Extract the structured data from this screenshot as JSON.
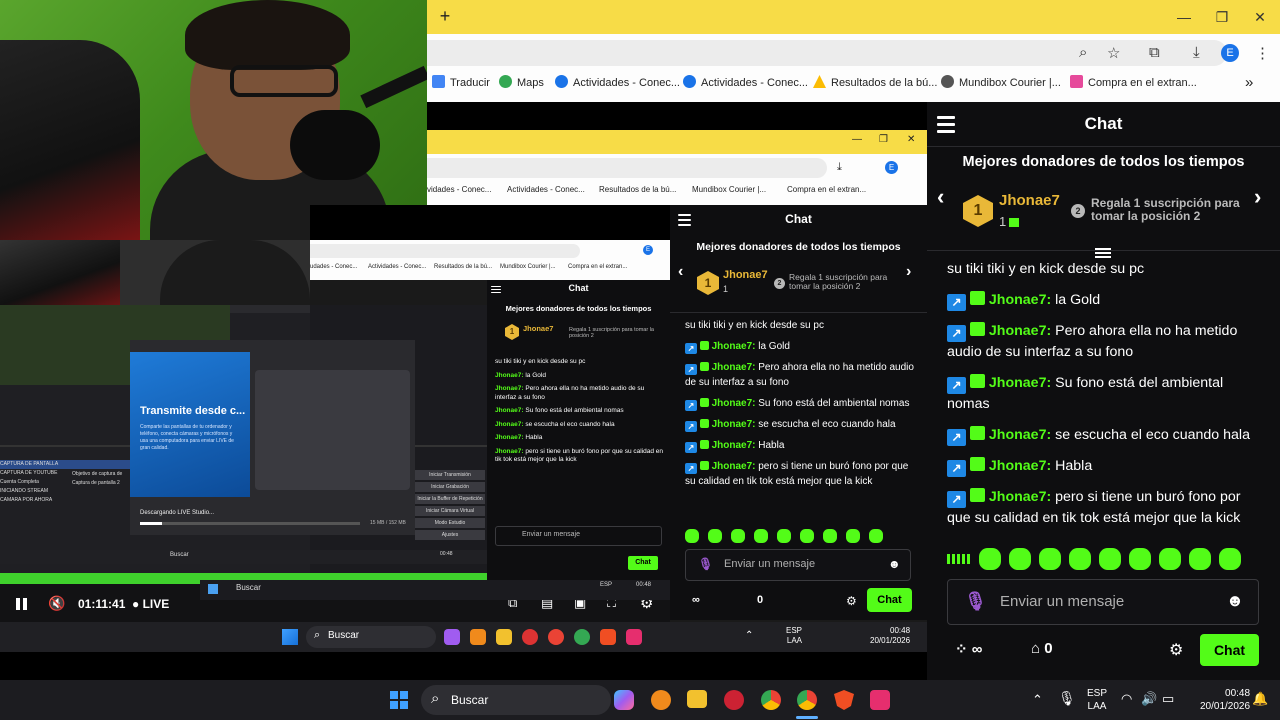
{
  "browser": {
    "avatar_letter": "E",
    "bookmarks": [
      "Traducir",
      "Maps",
      "Actividades - Conec...",
      "Actividades - Conec...",
      "Resultados de la bú...",
      "Mundibox Courier |...",
      "Compra en el extran..."
    ],
    "more": "»"
  },
  "chat": {
    "title": "Chat",
    "donors_title": "Mejores donadores de todos los tiempos",
    "top_donor": {
      "rank": "1",
      "name": "Jhonae7",
      "count": "1"
    },
    "second": {
      "rank": "2",
      "text": "Regala 1 suscripción para tomar la posición 2"
    },
    "messages": [
      {
        "user": "",
        "text": "su tiki tiki y en kick desde su pc"
      },
      {
        "user": "Jhonae7:",
        "text": " la Gold"
      },
      {
        "user": "Jhonae7:",
        "text": " Pero ahora ella no ha metido audio de su interfaz a su fono"
      },
      {
        "user": "Jhonae7:",
        "text": " Su fono está del ambiental nomas"
      },
      {
        "user": "Jhonae7:",
        "text": " se escucha el eco cuando hala"
      },
      {
        "user": "Jhonae7:",
        "text": " Habla"
      },
      {
        "user": "Jhonae7:",
        "text": " pero si tiene un buró fono por que su calidad en tik tok está mejor que la kick"
      }
    ],
    "input_placeholder": "Enviar un mensaje",
    "infinity": "∞",
    "zero": "0",
    "chat_button": "Chat"
  },
  "nested": {
    "bookmarks": [
      "vidades - Conec...",
      "Actividades - Conec...",
      "Resultados de la bú...",
      "Mundibox Courier |...",
      "Compra en el extran..."
    ],
    "bookmarks3": [
      "udades - Conec...",
      "Actividades - Conec...",
      "Resultados de la bú...",
      "Mundibox Courier |...",
      "Compra en el extran..."
    ]
  },
  "obs": {
    "dialog_title": "Transmite desde c...",
    "dialog_desc": "Comparte las pantallas de tu ordenador y teléfono, conecta cámaras y micrófonos y usa una computadora para enviar LIVE de gran calidad.",
    "downloading": "Descargando LIVE Studio...",
    "size": "15 MB / 152 MB",
    "scenes": [
      "CAPTURA DE PANTALLA",
      "CAPTURA DE YOUTUBE",
      "Cuenta Completa",
      "INICIANDO STREAM",
      "CAMARA POR AHORA"
    ],
    "buttons": [
      "Iniciar Transmisión",
      "Iniciar Grabación",
      "Iniciar la Buffer de Repetición",
      "Iniciar Cámara Virtual",
      "Modo Estudio",
      "Ajustes"
    ],
    "sources": [
      "Objetivo de captura de",
      "Captura de pantalla 2"
    ]
  },
  "player": {
    "time": "01:11:41",
    "live": "LIVE"
  },
  "taskbar": {
    "search": "Buscar",
    "lang1": "ESP",
    "lang2": "LAA",
    "time": "00:48",
    "date": "20/01/2026"
  }
}
